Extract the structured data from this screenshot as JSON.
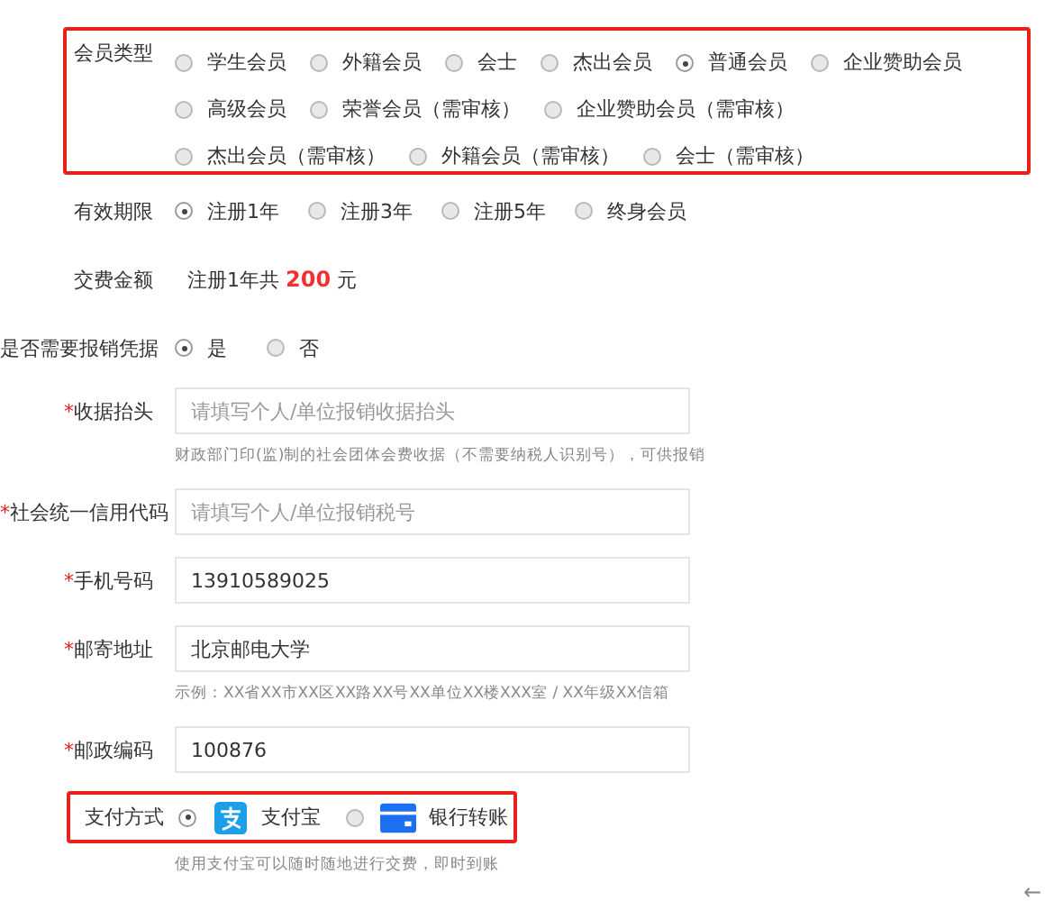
{
  "member_type": {
    "label": "会员类型",
    "options": [
      {
        "label": "学生会员",
        "selected": false
      },
      {
        "label": "外籍会员",
        "selected": false
      },
      {
        "label": "会士",
        "selected": false
      },
      {
        "label": "杰出会员",
        "selected": false
      },
      {
        "label": "普通会员",
        "selected": true
      },
      {
        "label": "企业赞助会员",
        "selected": false
      },
      {
        "label": "高级会员",
        "selected": false
      },
      {
        "label": "荣誉会员（需审核）",
        "selected": false
      },
      {
        "label": "企业赞助会员（需审核）",
        "selected": false
      },
      {
        "label": "杰出会员（需审核）",
        "selected": false
      },
      {
        "label": "外籍会员（需审核）",
        "selected": false
      },
      {
        "label": "会士（需审核）",
        "selected": false
      }
    ]
  },
  "validity": {
    "label": "有效期限",
    "options": [
      {
        "label": "注册1年",
        "selected": true
      },
      {
        "label": "注册3年",
        "selected": false
      },
      {
        "label": "注册5年",
        "selected": false
      },
      {
        "label": "终身会员",
        "selected": false
      }
    ]
  },
  "fee": {
    "label": "交费金额",
    "text_before": "注册1年共",
    "amount": "200",
    "unit": "元"
  },
  "receipt_needed": {
    "label": "是否需要报销凭据",
    "options": [
      {
        "label": "是",
        "selected": true
      },
      {
        "label": "否",
        "selected": false
      }
    ]
  },
  "fields": [
    {
      "label": "收据抬头",
      "required_mark": "*",
      "placeholder": "请填写个人/单位报销收据抬头",
      "hint": "财政部门印(监)制的社会团体会费收据（不需要纳税人识别号），可供报销"
    },
    {
      "label": "社会统一信用代码",
      "required_mark": "*",
      "placeholder": "请填写个人/单位报销税号"
    },
    {
      "label": "手机号码",
      "required_mark": "*",
      "value": "13910589025"
    },
    {
      "label": "邮寄地址",
      "required_mark": "*",
      "value": "北京邮电大学",
      "hint": "示例：XX省XX市XX区XX路XX号XX单位XX楼XXX室 / XX年级XX信箱"
    },
    {
      "label": "邮政编码",
      "required_mark": "*",
      "value": "100876"
    }
  ],
  "payment": {
    "label": "支付方式",
    "options": [
      {
        "label": "支付宝",
        "kind": "alipay",
        "selected": true
      },
      {
        "label": "银行转账",
        "kind": "bank",
        "selected": false
      }
    ],
    "hint": "使用支付宝可以随时随地进行交费，即时到账"
  },
  "back_arrow": "←"
}
